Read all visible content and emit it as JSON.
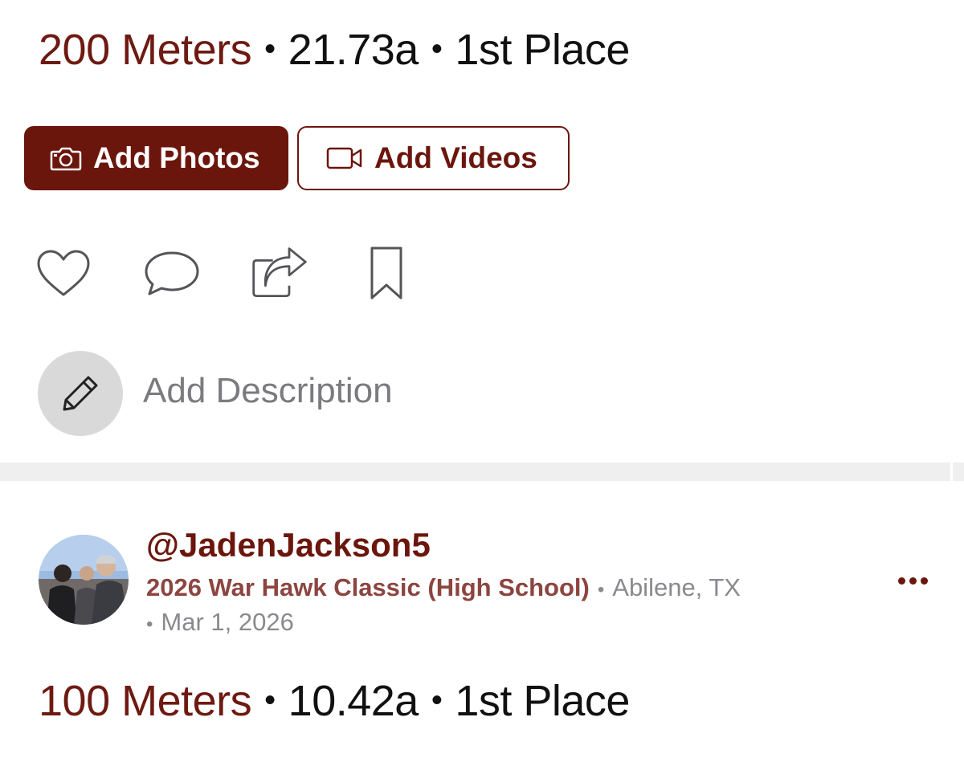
{
  "result_top": {
    "event": "200 Meters",
    "time": "21.73a",
    "place": "1st Place"
  },
  "buttons": {
    "add_photos": "Add Photos",
    "add_videos": "Add Videos"
  },
  "actions": {
    "icons": [
      "heart-icon",
      "comment-icon",
      "share-icon",
      "bookmark-icon"
    ]
  },
  "description": {
    "placeholder": "Add Description",
    "icon": "pencil-icon"
  },
  "post": {
    "username": "@JadenJackson5",
    "meet": "2026 War Hawk Classic (High School)",
    "location": "Abilene, TX",
    "date": "Mar 1, 2026",
    "menu_icon": "more-options-icon"
  },
  "result_bottom": {
    "event": "100 Meters",
    "time": "10.42a",
    "place": "1st Place"
  },
  "colors": {
    "brand": "#6b160d",
    "meet_text": "#8c4540",
    "muted": "#8a8a8e",
    "divider": "#efefef"
  }
}
